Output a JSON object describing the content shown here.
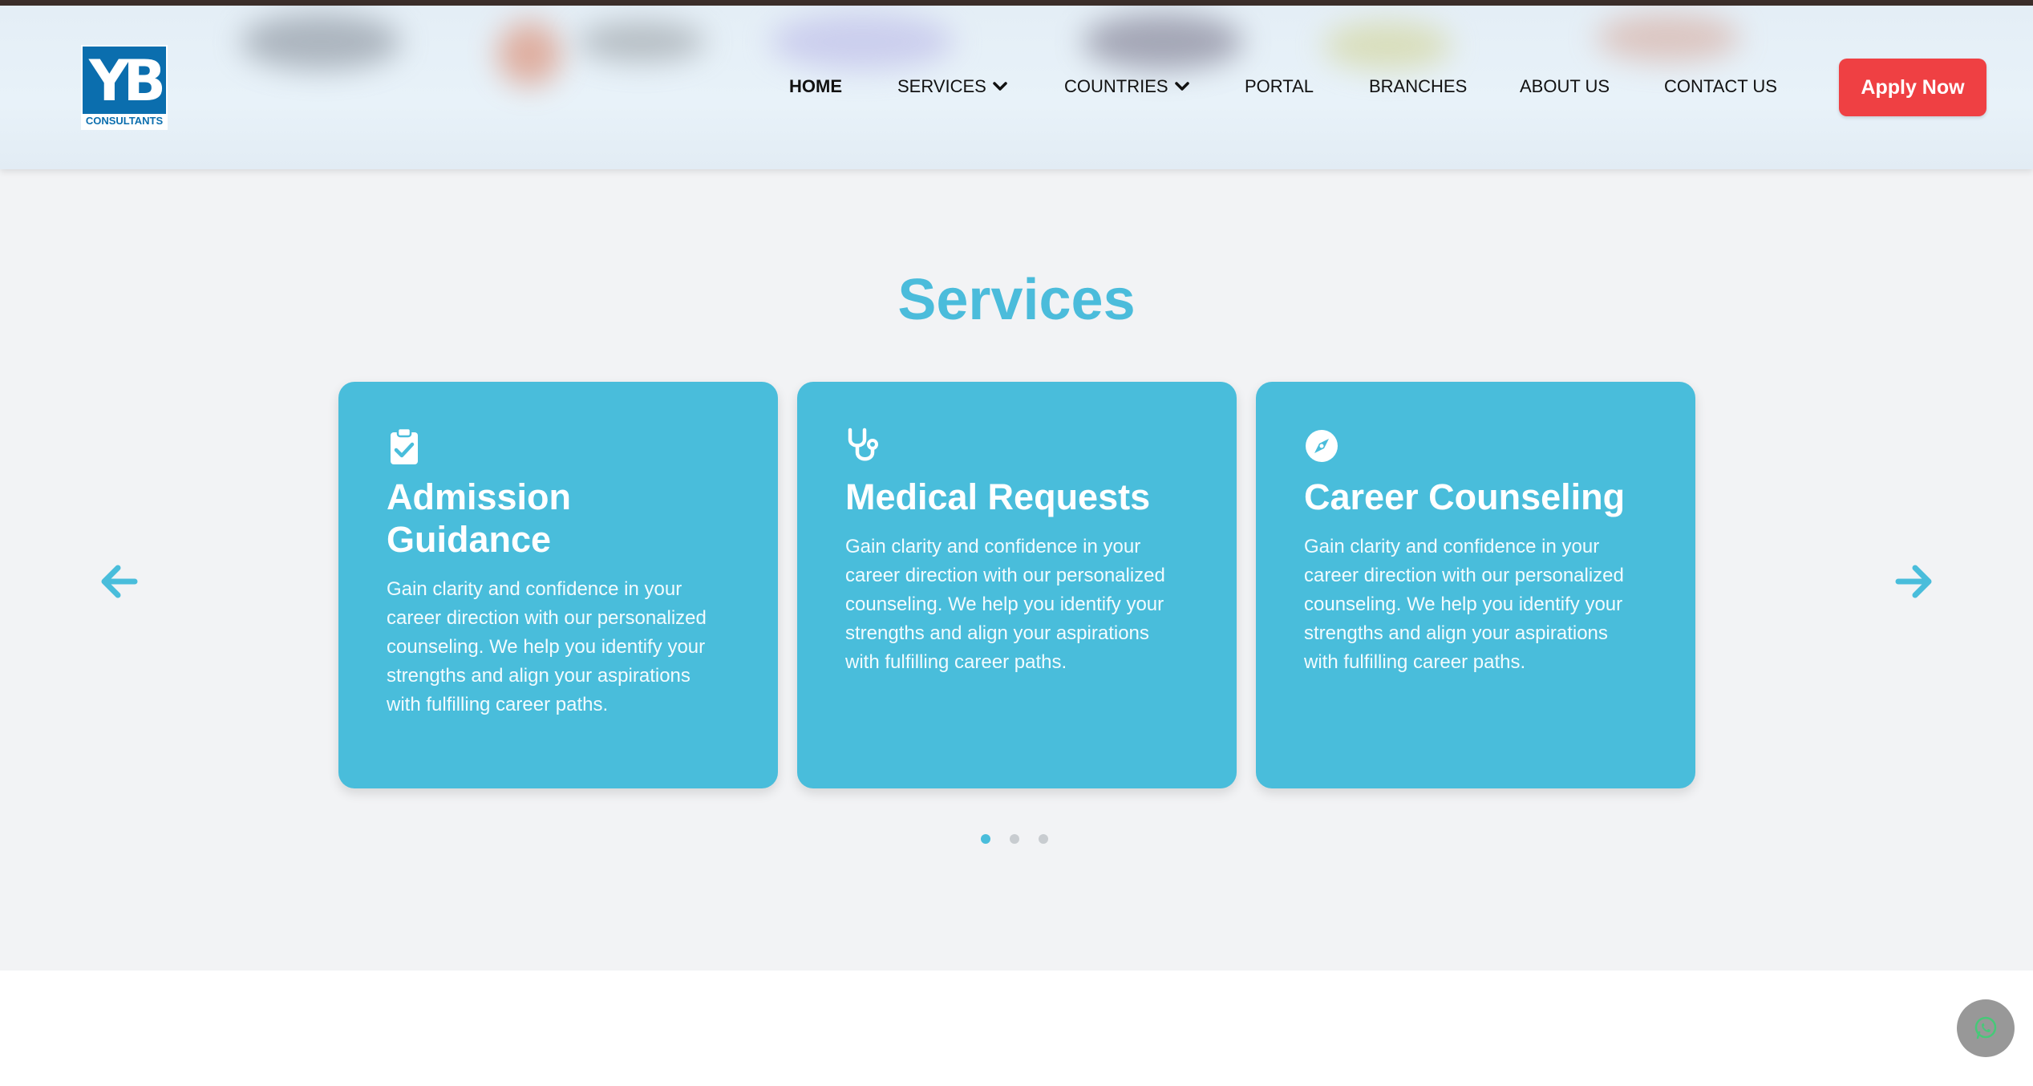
{
  "header": {
    "logo": {
      "mark": "YB",
      "sub": "CONSULTANTS"
    },
    "nav": [
      {
        "label": "HOME",
        "active": true
      },
      {
        "label": "SERVICES",
        "dropdown": true
      },
      {
        "label": "COUNTRIES",
        "dropdown": true
      },
      {
        "label": "PORTAL"
      },
      {
        "label": "BRANCHES"
      },
      {
        "label": "ABOUT US"
      },
      {
        "label": "CONTACT US"
      }
    ],
    "apply_label": "Apply Now"
  },
  "services": {
    "title": "Services",
    "cards": [
      {
        "icon": "clipboard-check-icon",
        "title": "Admission Guidance",
        "text": "Gain clarity and confidence in your career direction with our personalized counseling. We help you identify your strengths and align your aspirations with fulfilling career paths."
      },
      {
        "icon": "stethoscope-icon",
        "title": "Medical Requests",
        "text": "Gain clarity and confidence in your career direction with our personalized counseling. We help you identify your strengths and align your aspirations with fulfilling career paths."
      },
      {
        "icon": "compass-icon",
        "title": "Career Counseling",
        "text": "Gain clarity and confidence in your career direction with our personalized counseling. We help you identify your strengths and align your aspirations with fulfilling career paths."
      }
    ],
    "carousel": {
      "pages": 3,
      "active_page": 1
    }
  },
  "colors": {
    "accent": "#49bddb",
    "title": "#4bbcdb",
    "apply": "#ef4043",
    "background": "#f2f3f5"
  },
  "floating": {
    "icon": "whatsapp-icon"
  }
}
